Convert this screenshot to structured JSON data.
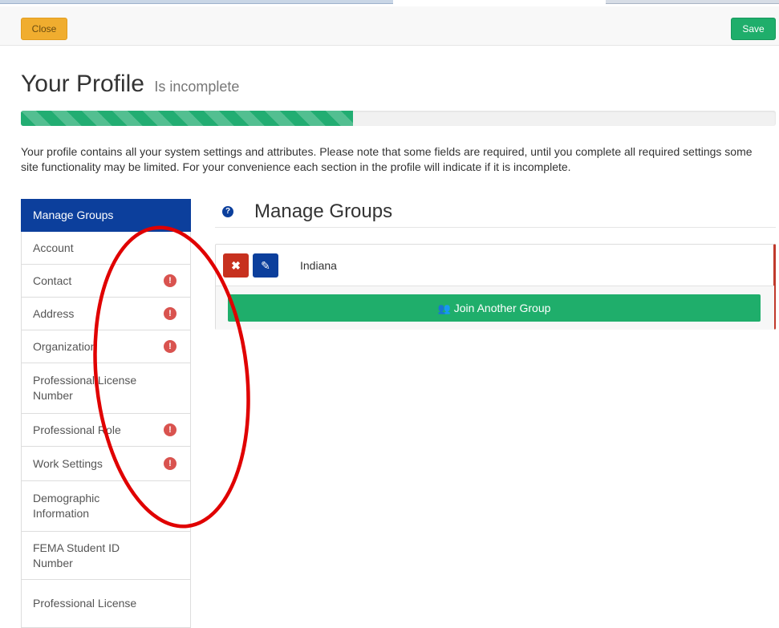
{
  "toolbar": {
    "close_label": "Close",
    "save_label": "Save"
  },
  "header": {
    "title": "Your Profile",
    "subtitle": "Is incomplete"
  },
  "progress": {
    "value_percent": 44
  },
  "description": "Your profile contains all your system settings and attributes. Please note that some fields are required, until you complete all required settings some site functionality may be limited. For your convenience each section in the profile will indicate if it is incomplete.",
  "sidebar": {
    "items": [
      {
        "label": "Manage Groups",
        "active": true,
        "incomplete": false
      },
      {
        "label": "Account",
        "active": false,
        "incomplete": false
      },
      {
        "label": "Contact",
        "active": false,
        "incomplete": true
      },
      {
        "label": "Address",
        "active": false,
        "incomplete": true
      },
      {
        "label": "Organization",
        "active": false,
        "incomplete": true
      },
      {
        "label": "Professional License Number",
        "active": false,
        "incomplete": false
      },
      {
        "label": "Professional Role",
        "active": false,
        "incomplete": true
      },
      {
        "label": "Work Settings",
        "active": false,
        "incomplete": true
      },
      {
        "label": "Demographic Information",
        "active": false,
        "incomplete": false
      },
      {
        "label": "FEMA Student ID Number",
        "active": false,
        "incomplete": false
      },
      {
        "label": "Professional License",
        "active": false,
        "incomplete": false
      }
    ],
    "warning_glyph": "!"
  },
  "section": {
    "title": "Manage Groups",
    "help_glyph": "?",
    "groups": [
      {
        "name": "Indiana"
      }
    ],
    "delete_glyph": "✖",
    "edit_glyph": "✎",
    "join_label": "Join Another Group",
    "join_glyph": "👥"
  },
  "colors": {
    "primary": "#0c3f9c",
    "success": "#1fae6b",
    "warning": "#f0ad2f",
    "danger": "#d9534f",
    "annotation": "#e00000"
  }
}
